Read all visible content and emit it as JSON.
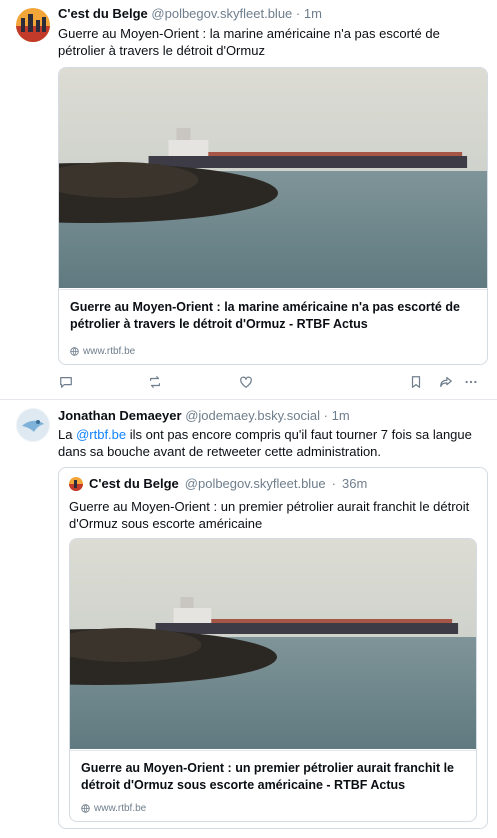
{
  "posts": [
    {
      "author": "C'est du Belge",
      "handle": "@polbegov.skyfleet.blue",
      "dot": "·",
      "time": "1m",
      "text": "Guerre au Moyen-Orient : la marine américaine n'a pas escorté de pétrolier à travers le détroit d'Ormuz",
      "card": {
        "title": "Guerre au Moyen-Orient : la marine américaine n'a pas escorté de pétrolier à travers le détroit d'Ormuz - RTBF Actus",
        "host": "www.rtbf.be"
      },
      "icons": [
        "reply-icon",
        "repost-icon",
        "like-icon",
        "bookmark-icon",
        "share-icon",
        "more-icon"
      ]
    },
    {
      "author": "Jonathan Demaeyer",
      "handle": "@jodemaey.bsky.social",
      "dot": "·",
      "time": "1m",
      "text_mention": "@rtbf.be",
      "text_prefix": "La ",
      "text_rest": " ils ont pas encore compris qu'il faut tourner 7 fois sa langue dans sa bouche avant de retweeter cette administration.",
      "quote": {
        "author": "C'est du Belge",
        "handle": "@polbegov.skyfleet.blue",
        "dot": "·",
        "time": "36m",
        "text": "Guerre au Moyen-Orient : un premier pétrolier aurait franchit le détroit d'Ormuz sous escorte américaine",
        "card": {
          "title": "Guerre au Moyen-Orient : un premier pétrolier aurait franchit le détroit d'Ormuz sous escorte américaine - RTBF Actus",
          "host": "www.rtbf.be"
        }
      }
    }
  ],
  "colors": {
    "link": "#1083fe",
    "muted": "#6f7e8c",
    "border": "#d4dbe2"
  }
}
